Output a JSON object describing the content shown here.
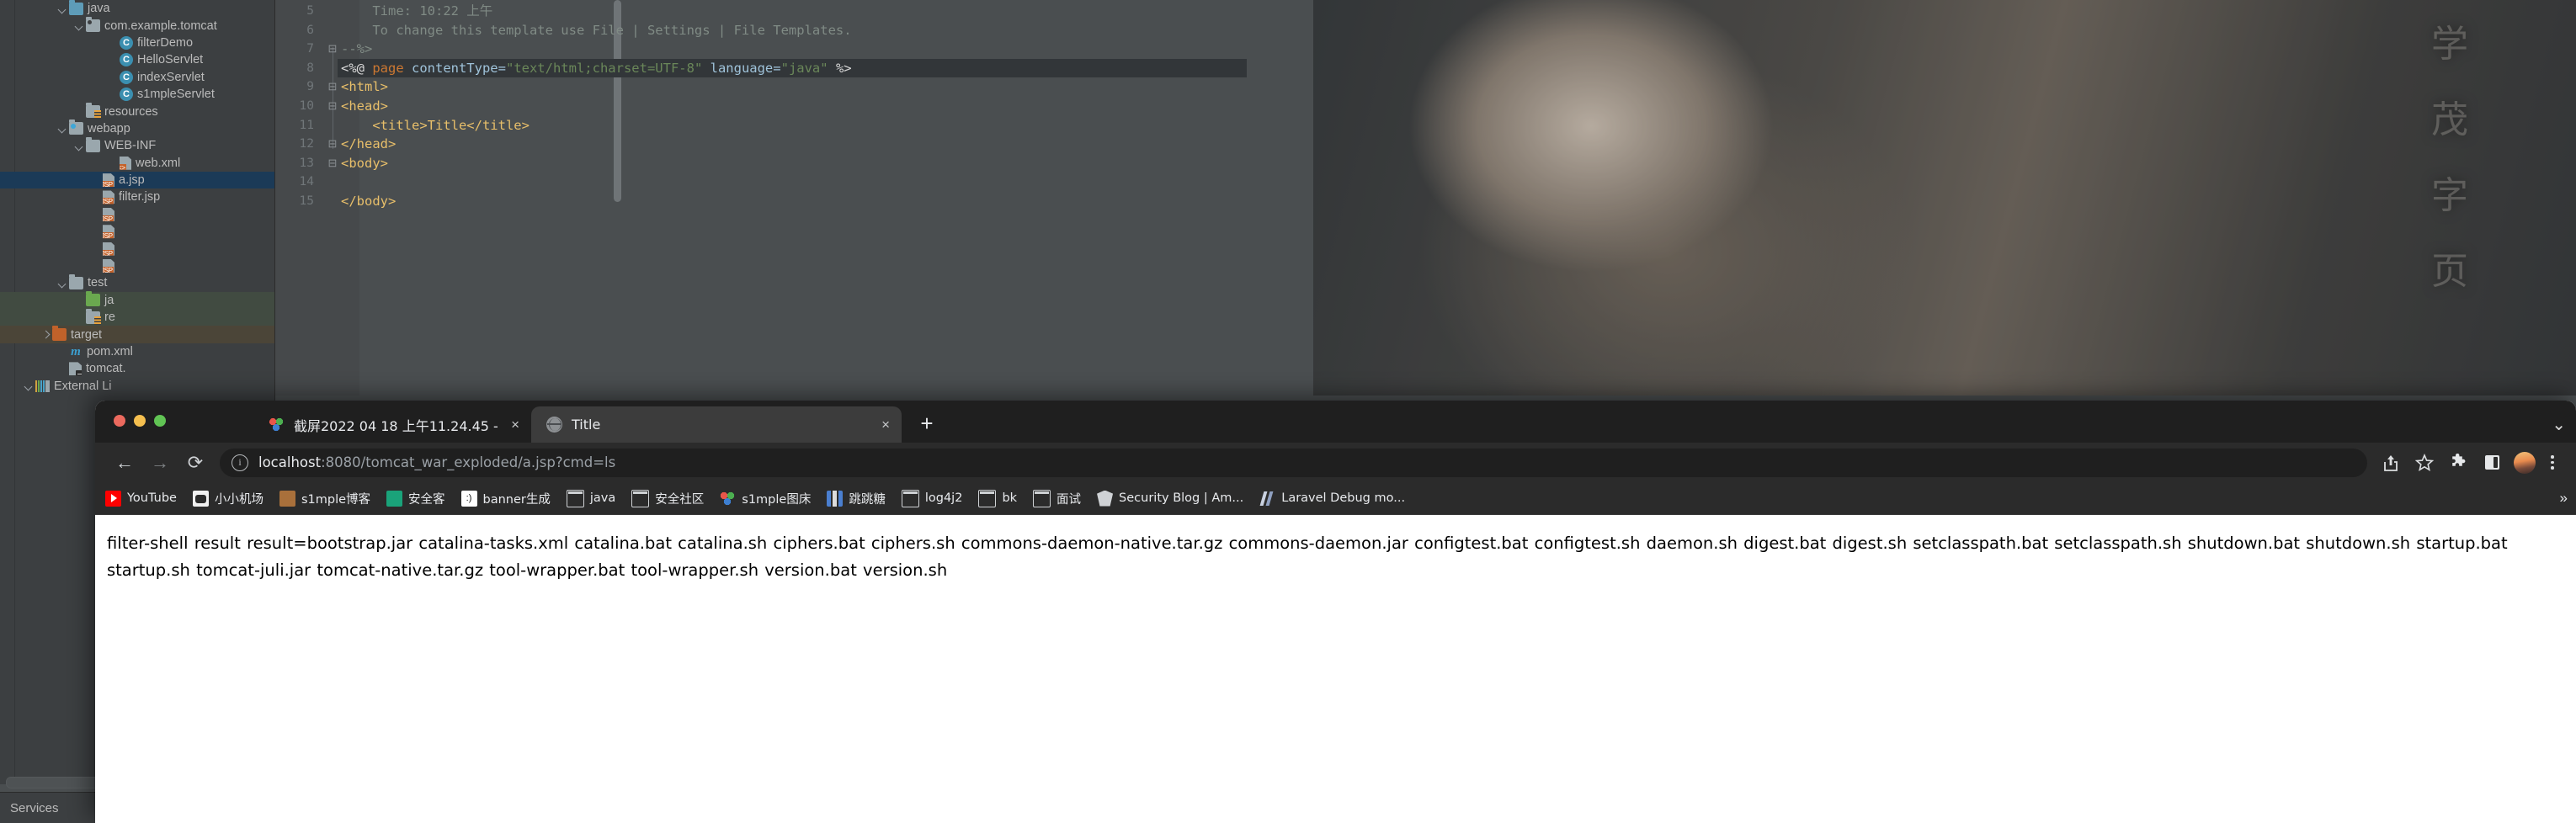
{
  "ide": {
    "project_tree": [
      {
        "label": "java",
        "indent": 3,
        "arrow": "down",
        "icon": "folder-source-blue",
        "state": "normal"
      },
      {
        "label": "com.example.tomcat",
        "indent": 4,
        "arrow": "down",
        "icon": "folder-package",
        "state": "normal"
      },
      {
        "label": "filterDemo",
        "indent": 6,
        "arrow": "none",
        "icon": "java-class",
        "state": "normal"
      },
      {
        "label": "HelloServlet",
        "indent": 6,
        "arrow": "none",
        "icon": "java-class",
        "state": "normal"
      },
      {
        "label": "indexServlet",
        "indent": 6,
        "arrow": "none",
        "icon": "java-class",
        "state": "normal"
      },
      {
        "label": "s1mpleServlet",
        "indent": 6,
        "arrow": "none",
        "icon": "java-class",
        "state": "normal"
      },
      {
        "label": "resources",
        "indent": 4,
        "arrow": "none",
        "icon": "folder-resources",
        "state": "normal"
      },
      {
        "label": "webapp",
        "indent": 3,
        "arrow": "down",
        "icon": "folder-webapp",
        "state": "normal"
      },
      {
        "label": "WEB-INF",
        "indent": 4,
        "arrow": "down",
        "icon": "folder-gray",
        "state": "normal"
      },
      {
        "label": "web.xml",
        "indent": 6,
        "arrow": "none",
        "icon": "file-xml",
        "state": "normal"
      },
      {
        "label": "a.jsp",
        "indent": 5,
        "arrow": "none",
        "icon": "file-jsp",
        "state": "selected"
      },
      {
        "label": "filter.jsp",
        "indent": 5,
        "arrow": "none",
        "icon": "file-jsp",
        "state": "normal"
      },
      {
        "label": "",
        "indent": 5,
        "arrow": "none",
        "icon": "file-jsp",
        "state": "normal"
      },
      {
        "label": "",
        "indent": 5,
        "arrow": "none",
        "icon": "file-jsp",
        "state": "normal"
      },
      {
        "label": "",
        "indent": 5,
        "arrow": "none",
        "icon": "file-jsp",
        "state": "normal"
      },
      {
        "label": "",
        "indent": 5,
        "arrow": "none",
        "icon": "file-jsp",
        "state": "normal"
      },
      {
        "label": "test",
        "indent": 3,
        "arrow": "down",
        "icon": "folder-gray",
        "state": "normal"
      },
      {
        "label": "ja",
        "indent": 4,
        "arrow": "none",
        "icon": "folder-test-green",
        "state": "green"
      },
      {
        "label": "re",
        "indent": 4,
        "arrow": "none",
        "icon": "folder-test-resources",
        "state": "green"
      },
      {
        "label": "target",
        "indent": 2,
        "arrow": "right",
        "icon": "folder-orange",
        "state": "target"
      },
      {
        "label": "pom.xml",
        "indent": 3,
        "arrow": "none",
        "icon": "maven-m",
        "state": "normal"
      },
      {
        "label": "tomcat.",
        "indent": 3,
        "arrow": "none",
        "icon": "file-script",
        "state": "normal"
      },
      {
        "label": "External Li",
        "indent": 1,
        "arrow": "down",
        "icon": "external-libraries",
        "state": "normal"
      }
    ],
    "services_label": "Services",
    "editor": {
      "lines": [
        {
          "num": "5",
          "fold": "",
          "segments": [
            {
              "t": "    Time: 10:22 上午",
              "c": "k-com"
            }
          ]
        },
        {
          "num": "6",
          "fold": "",
          "segments": [
            {
              "t": "    To change this template use File | Settings | File Templates.",
              "c": "k-com"
            }
          ]
        },
        {
          "num": "7",
          "fold": "minus",
          "segments": [
            {
              "t": "--%>",
              "c": "k-com"
            }
          ]
        },
        {
          "num": "8",
          "fold": "",
          "segments": [
            {
              "t": "<%@ ",
              "c": "k-white"
            },
            {
              "t": "page",
              "c": "k-kw"
            },
            {
              "t": " contentType=",
              "c": "k-attr"
            },
            {
              "t": "\"text/html;charset=UTF-8\"",
              "c": "k-str"
            },
            {
              "t": " language=",
              "c": "k-attr"
            },
            {
              "t": "\"java\"",
              "c": "k-str"
            },
            {
              "t": " %>",
              "c": "k-white"
            }
          ]
        },
        {
          "num": "9",
          "fold": "minus",
          "segments": [
            {
              "t": "<html>",
              "c": "k-tag"
            }
          ]
        },
        {
          "num": "10",
          "fold": "minus",
          "segments": [
            {
              "t": "<head>",
              "c": "k-tag"
            }
          ]
        },
        {
          "num": "11",
          "fold": "",
          "segments": [
            {
              "t": "    <title>Title</title>",
              "c": "k-tag"
            }
          ]
        },
        {
          "num": "12",
          "fold": "minus",
          "segments": [
            {
              "t": "</head>",
              "c": "k-tag"
            }
          ]
        },
        {
          "num": "13",
          "fold": "minus",
          "segments": [
            {
              "t": "<body>",
              "c": "k-tag"
            }
          ]
        },
        {
          "num": "14",
          "fold": "",
          "segments": [
            {
              "t": "",
              "c": "k-tag"
            }
          ]
        },
        {
          "num": "15",
          "fold": "",
          "segments": [
            {
              "t": "</body>",
              "c": "k-tag"
            }
          ]
        }
      ]
    },
    "watermark_chars": [
      "学",
      "茂",
      "字",
      "页"
    ]
  },
  "browser": {
    "tabs": [
      {
        "title": "截屏2022 04 18 上午11.24.45 -",
        "favicon": "screenshot-icon",
        "active": false,
        "close": "×"
      },
      {
        "title": "Title",
        "favicon": "globe-icon",
        "active": true,
        "close": "×"
      }
    ],
    "new_tab_label": "+",
    "window_chevron": "⌄",
    "toolbar": {
      "back": "←",
      "forward": "→",
      "reload": "⟳",
      "info_icon": "ⓘ",
      "url_host": "localhost",
      "url_rest": ":8080/tomcat_war_exploded/a.jsp?cmd=ls",
      "share_icon": "share-icon",
      "bookmark_star": "☆",
      "extensions_icon": "puzzle-icon",
      "sidepanel_icon": "panel-icon",
      "kebab_icon": "kebab-menu-icon"
    },
    "bookmarks": [
      {
        "label": "YouTube",
        "icon": "bi-yt"
      },
      {
        "label": "小小机场",
        "icon": "bi-panda"
      },
      {
        "label": "s1mple博客",
        "icon": "bi-dog"
      },
      {
        "label": "安全客",
        "icon": "bi-green"
      },
      {
        "label": "banner生成",
        "icon": "bi-face"
      },
      {
        "label": "java",
        "icon": "bi-fold"
      },
      {
        "label": "安全社区",
        "icon": "bi-fold"
      },
      {
        "label": "s1mple图床",
        "icon": "bi-3dots"
      },
      {
        "label": "跳跳糖",
        "icon": "bi-ttt"
      },
      {
        "label": "log4j2",
        "icon": "bi-fold"
      },
      {
        "label": "bk",
        "icon": "bi-fold"
      },
      {
        "label": "面试",
        "icon": "bi-fold"
      },
      {
        "label": "Security Blog | Am...",
        "icon": "bi-shield"
      },
      {
        "label": "Laravel Debug mo...",
        "icon": "bi-laravel"
      }
    ],
    "bookmarks_overflow": "»",
    "page_body": "filter-shell result result=bootstrap.jar catalina-tasks.xml catalina.bat catalina.sh ciphers.bat ciphers.sh commons-daemon-native.tar.gz commons-daemon.jar configtest.bat configtest.sh daemon.sh digest.bat digest.sh setclasspath.bat setclasspath.sh shutdown.bat shutdown.sh startup.bat startup.sh tomcat-juli.jar tomcat-native.tar.gz tool-wrapper.bat tool-wrapper.sh version.bat version.sh"
  }
}
